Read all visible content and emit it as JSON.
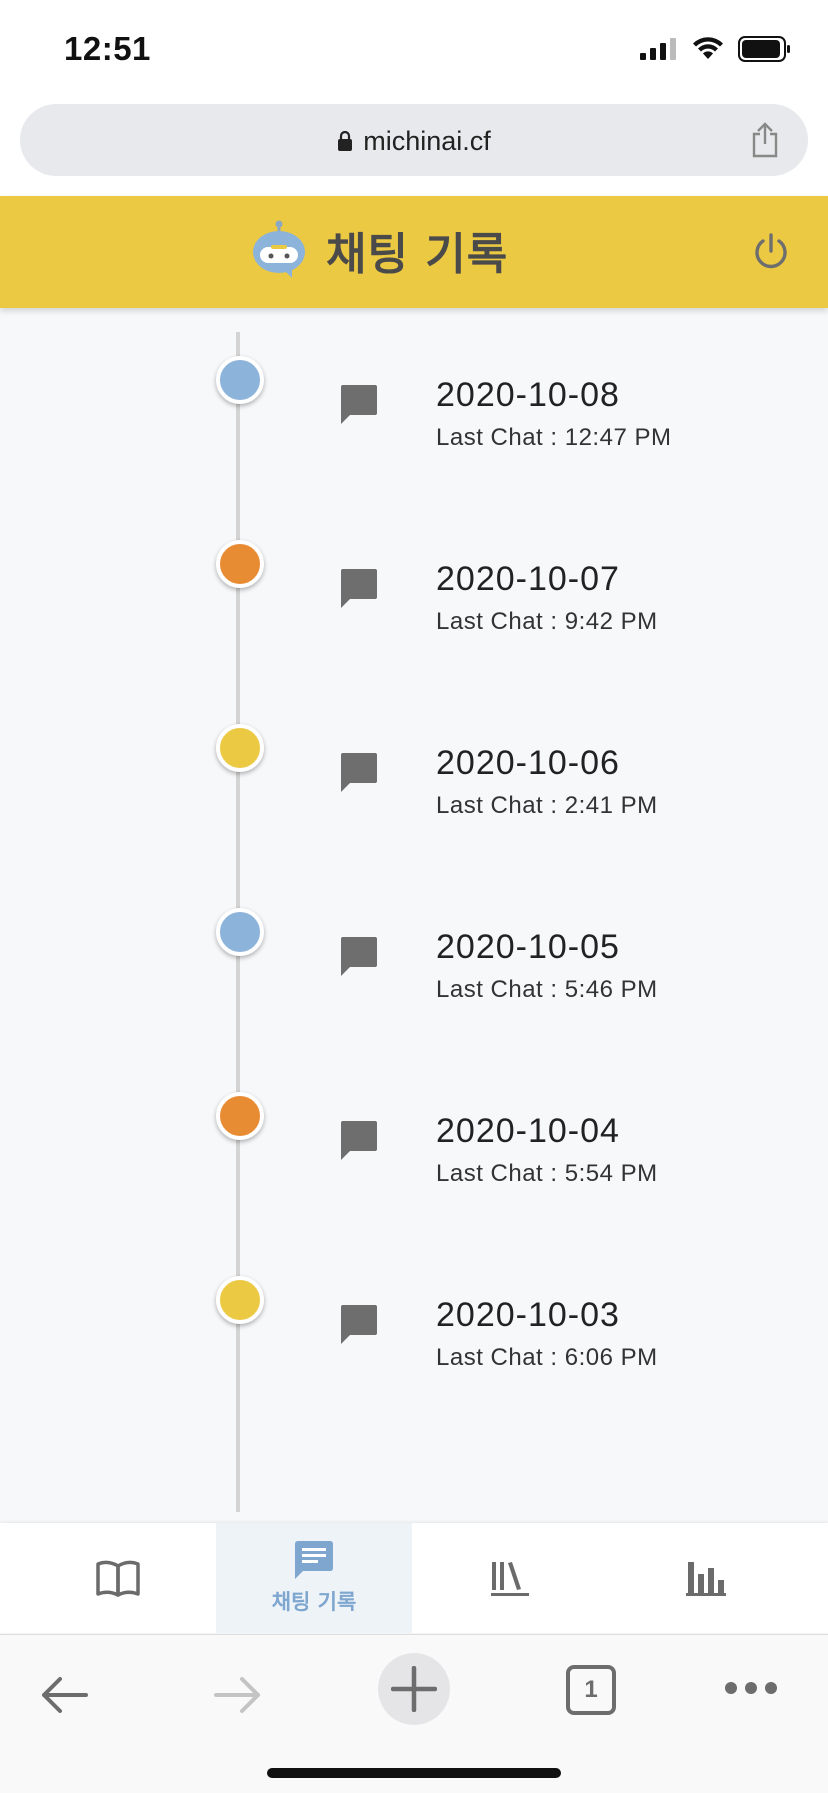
{
  "status_bar": {
    "time": "12:51"
  },
  "browser": {
    "url": "michinai.cf",
    "tab_count": "1"
  },
  "header": {
    "title": "채팅 기록",
    "accent_color": "#ecc942"
  },
  "timeline": [
    {
      "date": "2020-10-08",
      "last_chat": "Last Chat : 12:47 PM",
      "dot_color": "#8cb3da"
    },
    {
      "date": "2020-10-07",
      "last_chat": "Last Chat : 9:42 PM",
      "dot_color": "#e88c33"
    },
    {
      "date": "2020-10-06",
      "last_chat": "Last Chat : 2:41 PM",
      "dot_color": "#ecc942"
    },
    {
      "date": "2020-10-05",
      "last_chat": "Last Chat : 5:46 PM",
      "dot_color": "#8cb3da"
    },
    {
      "date": "2020-10-04",
      "last_chat": "Last Chat : 5:54 PM",
      "dot_color": "#e88c33"
    },
    {
      "date": "2020-10-03",
      "last_chat": "Last Chat : 6:06 PM",
      "dot_color": "#ecc942"
    }
  ],
  "bottom_nav": {
    "items": [
      {
        "icon": "book-open-icon",
        "label": ""
      },
      {
        "icon": "chat-icon",
        "label": "채팅 기록",
        "active": true
      },
      {
        "icon": "library-icon",
        "label": ""
      },
      {
        "icon": "bar-chart-icon",
        "label": ""
      }
    ],
    "active_color": "#7ea6cf"
  }
}
